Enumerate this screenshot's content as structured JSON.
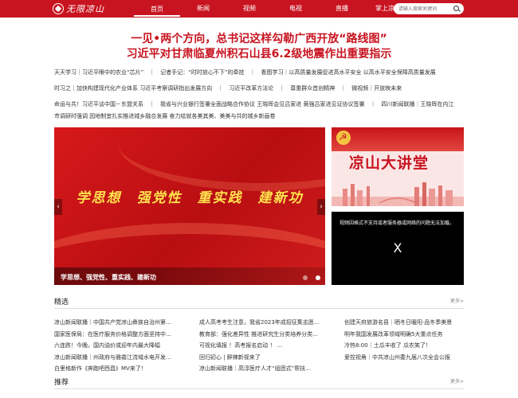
{
  "header": {
    "logo_text": "无限凉山",
    "nav": [
      "首页",
      "新闻",
      "视频",
      "电视",
      "直播",
      "掌上凉山"
    ],
    "search_placeholder": "请输入搜索关键词"
  },
  "headlines": [
    "一见•两个方向，总书记这样勾勒广西开放“路线图”",
    "习近平对甘肃临夏州积石山县6.2级地震作出重要指示"
  ],
  "tickers": [
    "天天学习｜习近平眼中的农业“芯片”　｜　记者手记：“时时放心不下”的牵挂　｜　看图学习｜以高质量发展促进高水平安全 以高水平安全保障高质量发展",
    "时习之｜加快构建现代化产业体系 习近平考察调研指出发展方向　｜　习近平改革方法论　｜　尊重群众首创精神　｜　微视频｜开放映未来",
    "命运与共！习近平谈中国－东盟关系　｜　我省与兴业银行签署全面战略合作协议 王晓晖会见吕家进 黄强吕家进见证协议签署　｜　四川新闻联播｜王晓晖在内江",
    "市调研时强调 因地制宜扎实推进城乡融合发展 奋力绘就各美其美、美美与共的城乡新画卷"
  ],
  "banner": {
    "slogan": "学思想　强党性　重实践　建新功",
    "caption": "学思想、强党性、重实践、建新功",
    "prev_icon": "‹",
    "next_icon": "›"
  },
  "promo": {
    "title": "凉山大讲堂"
  },
  "video": {
    "message": "视频因格式不支持或者服务器或网络的问题无法加载。",
    "close_glyph": "X"
  },
  "featured": {
    "title": "精选",
    "more": "更多>",
    "col1": [
      "凉山新闻联播｜中国共产党凉山彝族自治州第...",
      "国家医保局：在医疗服务价格调整方面坚持中...",
      "六连跌！今晚，国内油价或迎年内最大降幅",
      "凉山新闻联播｜州政府与雅砻江流域水电开发...",
      "白里格新作《奔跑吧西昌》MV来了！"
    ],
    "col2": [
      "成人高考考生注意，我省2023年成招征集志愿...",
      "教育部：强化差异性 推进研究生分类培养分类...",
      "可视化填报 ！高考报名启动 ！ ...",
      "回归初心 | 鲜辣新视来了",
      "凉山新闻联播｜高淳医疗人才“组团式”帮扶..."
    ],
    "col3": [
      "创建天府旅游名县｜晒冬日暖阳·品冬季美景",
      "明年我国发展改革领域明确5大重点任务",
      "冷热8:00｜土瓜丰收了 瓜农笑了！",
      "爱控视角｜中共凉山州委九届八次全会公报",
      ""
    ]
  },
  "recommend": {
    "title": "推荐",
    "more": "更多>"
  },
  "colors": {
    "brand_red": "#c81420",
    "slogan_yellow": "#ffe34d"
  }
}
